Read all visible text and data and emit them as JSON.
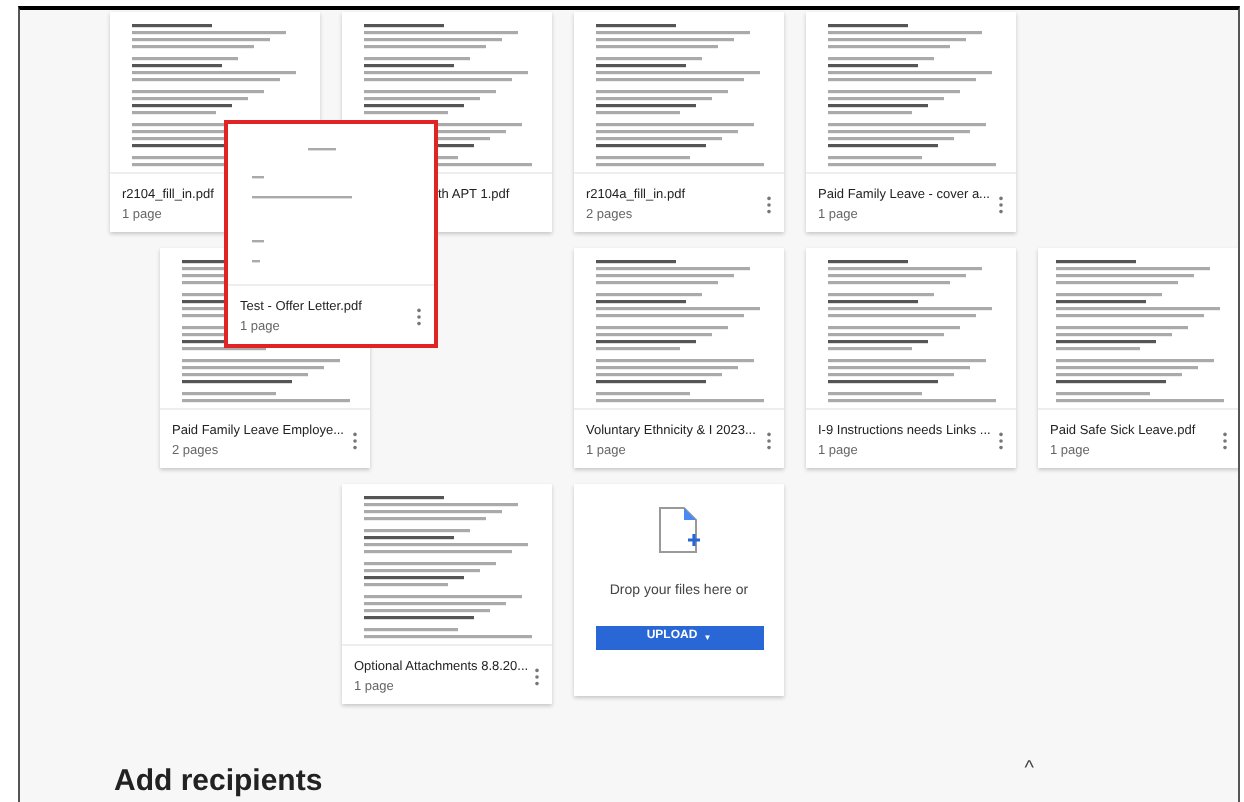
{
  "documents": [
    {
      "name": "r2104_fill_in.pdf",
      "pages": "1 page"
    },
    {
      "name": "th APT 1.pdf"
    },
    {
      "name": "r2104a_fill_in.pdf",
      "pages": "2 pages"
    },
    {
      "name": "Paid Family Leave - cover a...",
      "pages": "1 page"
    },
    {
      "name": "Paid Family Leave Employe...",
      "pages": "2 pages"
    },
    {
      "name": "Voluntary Ethnicity & I 2023...",
      "pages": "1 page"
    },
    {
      "name": "I-9 Instructions needs Links ...",
      "pages": "1 page"
    },
    {
      "name": "Paid Safe Sick Leave.pdf",
      "pages": "1 page"
    },
    {
      "name": "Optional Attachments 8.8.20...",
      "pages": "1 page"
    }
  ],
  "dragged_document": {
    "name": "Test - Offer Letter.pdf",
    "pages": "1 page"
  },
  "drop_zone": {
    "text": "Drop your files here or",
    "button": "UPLOAD",
    "caret": "▼"
  },
  "section": {
    "title": "Add recipients",
    "toggle": "^"
  }
}
